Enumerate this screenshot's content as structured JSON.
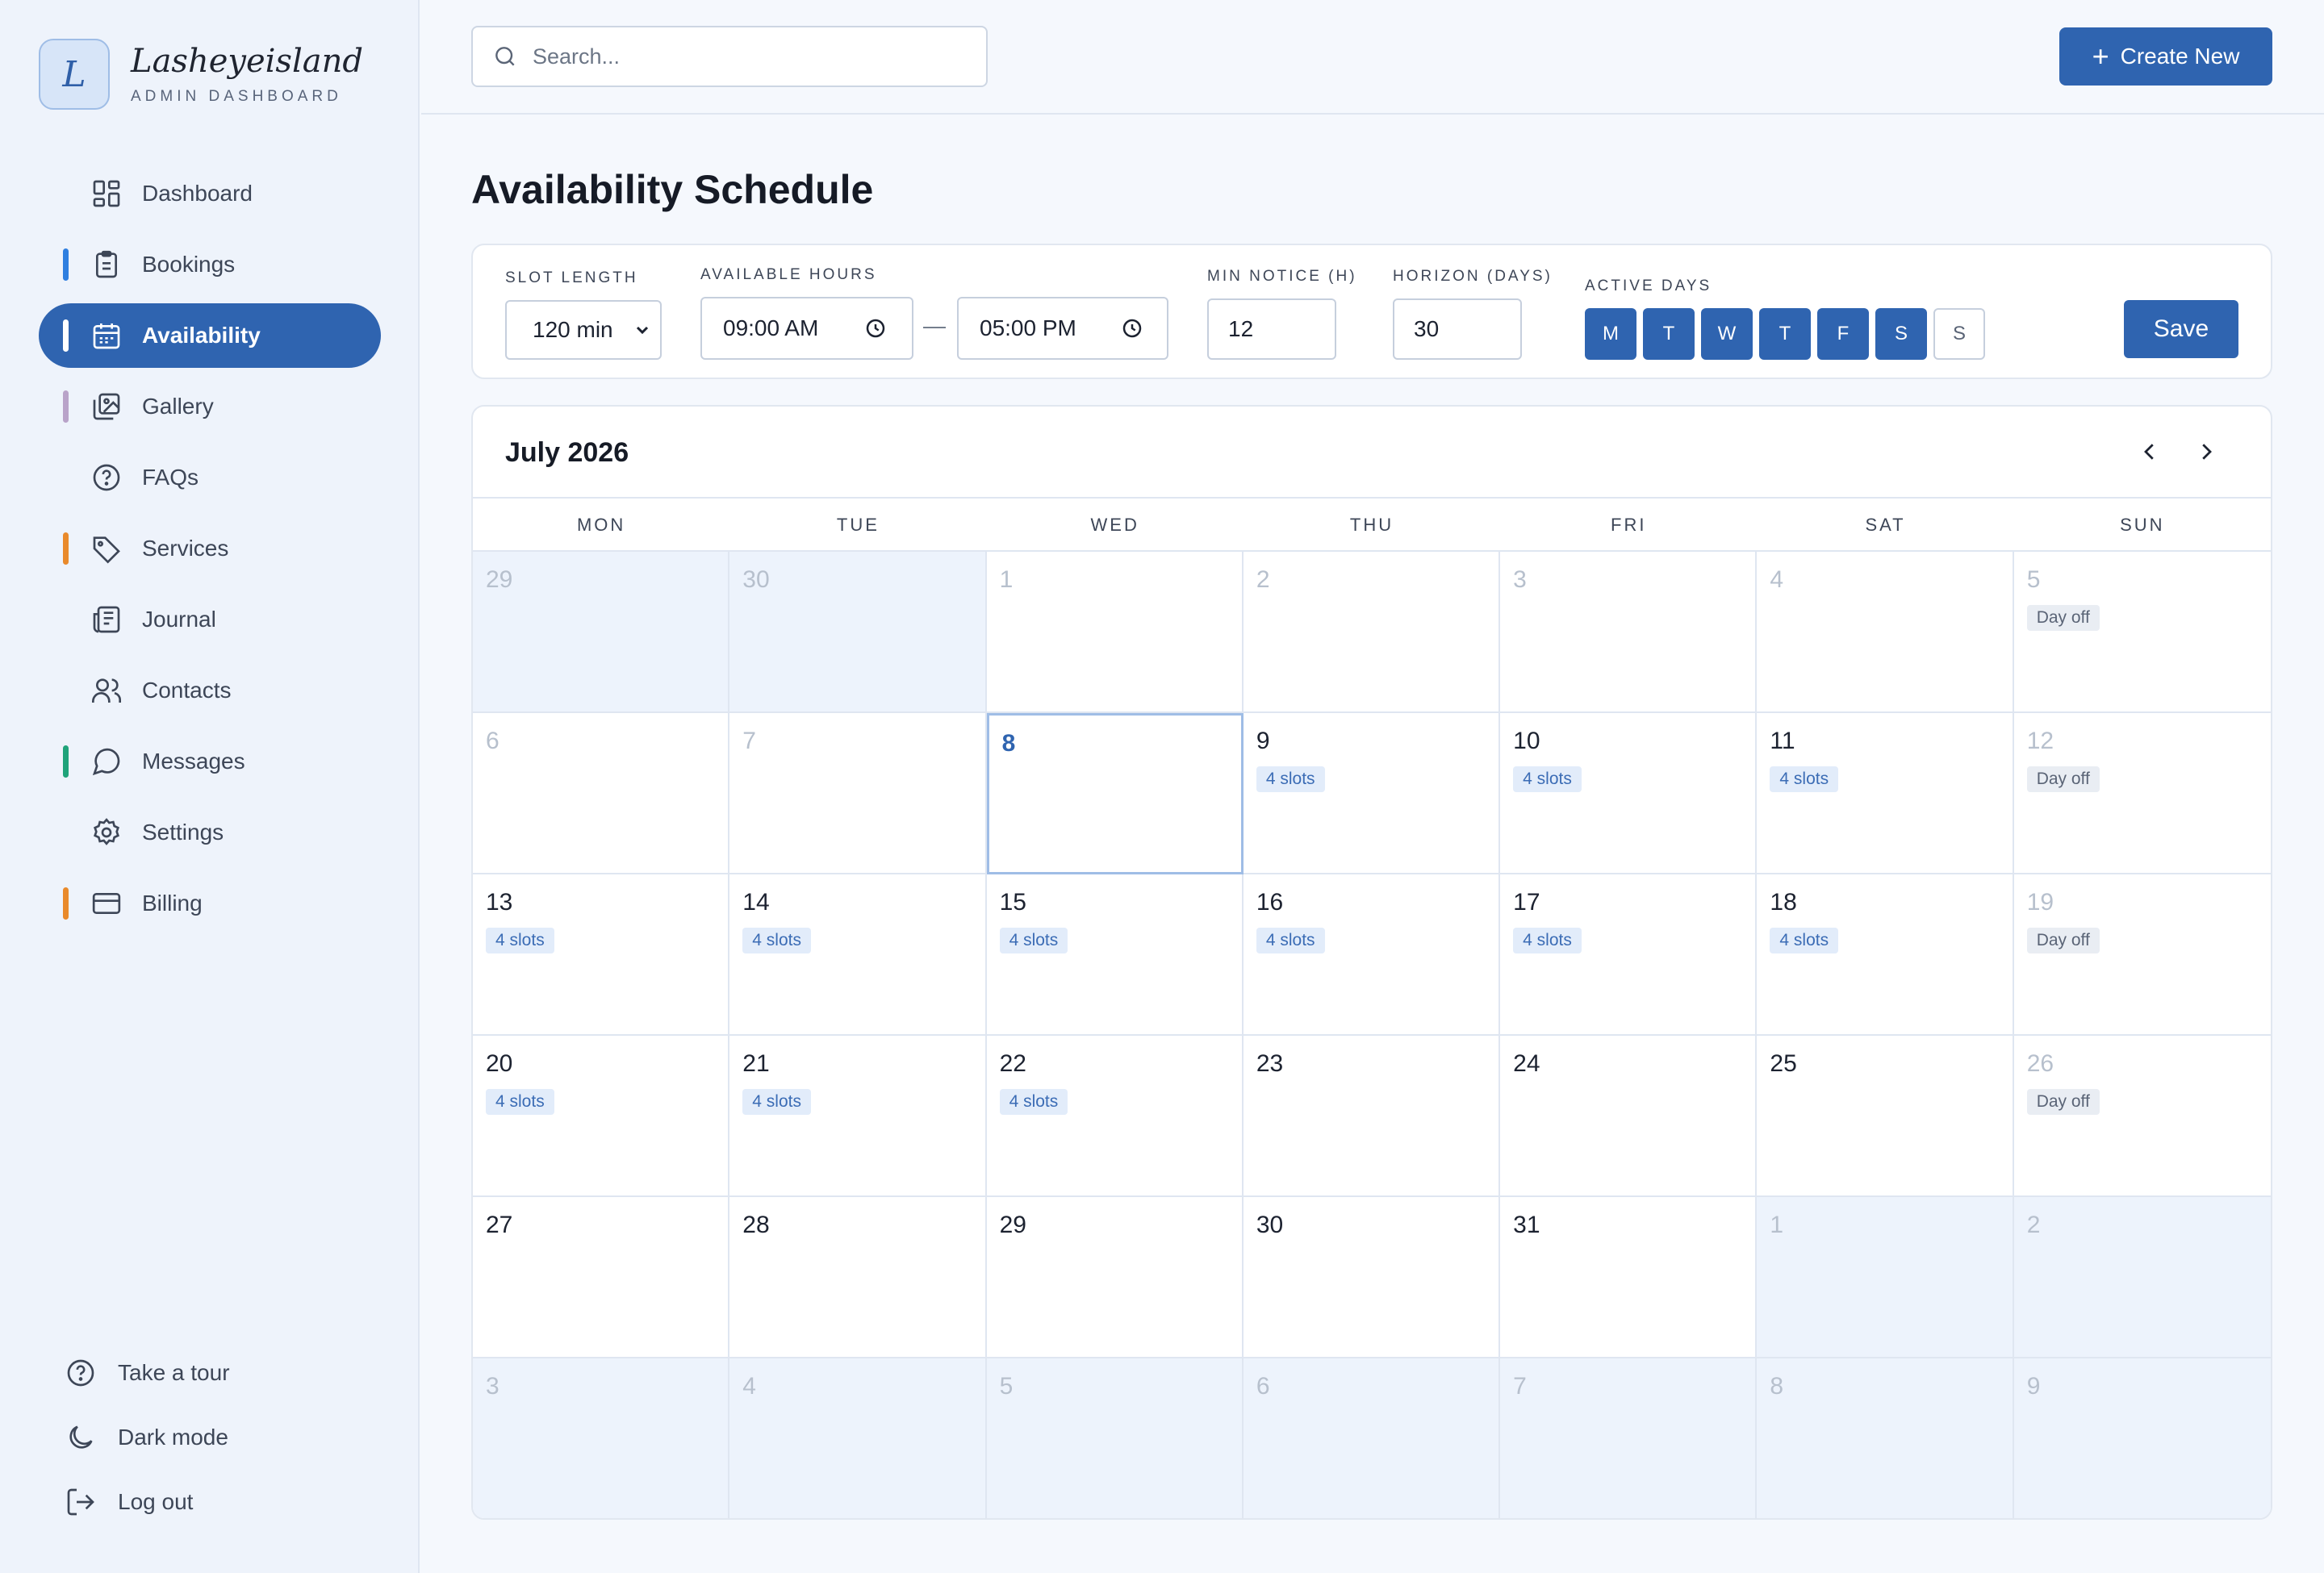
{
  "brand": {
    "initial": "L",
    "name": "Lasheyeisland",
    "subtitle": "ADMIN DASHBOARD"
  },
  "sidebar": {
    "items": [
      {
        "label": "Dashboard",
        "icon": "dashboard-icon",
        "accent": "",
        "active": false
      },
      {
        "label": "Bookings",
        "icon": "clipboard-icon",
        "accent": "#2f7fe0",
        "active": false
      },
      {
        "label": "Availability",
        "icon": "calendar-icon",
        "accent": "#ffffff",
        "active": true
      },
      {
        "label": "Gallery",
        "icon": "gallery-icon",
        "accent": "#b9a3c9",
        "active": false
      },
      {
        "label": "FAQs",
        "icon": "help-circle-icon",
        "accent": "",
        "active": false
      },
      {
        "label": "Services",
        "icon": "tag-icon",
        "accent": "#e98a2b",
        "active": false
      },
      {
        "label": "Journal",
        "icon": "newspaper-icon",
        "accent": "",
        "active": false
      },
      {
        "label": "Contacts",
        "icon": "users-icon",
        "accent": "",
        "active": false
      },
      {
        "label": "Messages",
        "icon": "message-icon",
        "accent": "#1fa37a",
        "active": false
      },
      {
        "label": "Settings",
        "icon": "gear-icon",
        "accent": "",
        "active": false
      },
      {
        "label": "Billing",
        "icon": "credit-card-icon",
        "accent": "#e98a2b",
        "active": false
      }
    ],
    "footer": [
      {
        "label": "Take a tour",
        "icon": "help-circle-icon"
      },
      {
        "label": "Dark mode",
        "icon": "moon-icon"
      },
      {
        "label": "Log out",
        "icon": "logout-icon"
      }
    ]
  },
  "topbar": {
    "search_placeholder": "Search...",
    "create_label": "Create New"
  },
  "page": {
    "title": "Availability Schedule"
  },
  "settings": {
    "slot_length_label": "SLOT LENGTH",
    "slot_length_value": "120 min",
    "available_hours_label": "AVAILABLE HOURS",
    "start_time": "09:00 AM",
    "end_time": "05:00 PM",
    "separator": "—",
    "min_notice_label": "MIN NOTICE (H)",
    "min_notice_value": "12",
    "horizon_label": "HORIZON (DAYS)",
    "horizon_value": "30",
    "active_days_label": "ACTIVE DAYS",
    "days": [
      {
        "label": "M",
        "active": true
      },
      {
        "label": "T",
        "active": true
      },
      {
        "label": "W",
        "active": true
      },
      {
        "label": "T",
        "active": true
      },
      {
        "label": "F",
        "active": true
      },
      {
        "label": "S",
        "active": true
      },
      {
        "label": "S",
        "active": false
      }
    ],
    "save_label": "Save"
  },
  "calendar": {
    "month_label": "July 2026",
    "weekdays": [
      "MON",
      "TUE",
      "WED",
      "THU",
      "FRI",
      "SAT",
      "SUN"
    ],
    "weeks": [
      [
        {
          "day": "29",
          "muted": true,
          "other": true,
          "badge": "",
          "badge_type": ""
        },
        {
          "day": "30",
          "muted": true,
          "other": true,
          "badge": "",
          "badge_type": ""
        },
        {
          "day": "1",
          "muted": true,
          "other": false,
          "badge": "",
          "badge_type": ""
        },
        {
          "day": "2",
          "muted": true,
          "other": false,
          "badge": "",
          "badge_type": ""
        },
        {
          "day": "3",
          "muted": true,
          "other": false,
          "badge": "",
          "badge_type": ""
        },
        {
          "day": "4",
          "muted": true,
          "other": false,
          "badge": "",
          "badge_type": ""
        },
        {
          "day": "5",
          "muted": true,
          "other": false,
          "badge": "Day off",
          "badge_type": "off"
        }
      ],
      [
        {
          "day": "6",
          "muted": true,
          "other": false,
          "badge": "",
          "badge_type": ""
        },
        {
          "day": "7",
          "muted": true,
          "other": false,
          "badge": "",
          "badge_type": ""
        },
        {
          "day": "8",
          "muted": false,
          "other": false,
          "today": true,
          "badge": "",
          "badge_type": ""
        },
        {
          "day": "9",
          "muted": false,
          "other": false,
          "badge": "4 slots",
          "badge_type": "slots"
        },
        {
          "day": "10",
          "muted": false,
          "other": false,
          "badge": "4 slots",
          "badge_type": "slots"
        },
        {
          "day": "11",
          "muted": false,
          "other": false,
          "badge": "4 slots",
          "badge_type": "slots"
        },
        {
          "day": "12",
          "muted": true,
          "other": false,
          "badge": "Day off",
          "badge_type": "off"
        }
      ],
      [
        {
          "day": "13",
          "muted": false,
          "other": false,
          "badge": "4 slots",
          "badge_type": "slots"
        },
        {
          "day": "14",
          "muted": false,
          "other": false,
          "badge": "4 slots",
          "badge_type": "slots"
        },
        {
          "day": "15",
          "muted": false,
          "other": false,
          "badge": "4 slots",
          "badge_type": "slots"
        },
        {
          "day": "16",
          "muted": false,
          "other": false,
          "badge": "4 slots",
          "badge_type": "slots"
        },
        {
          "day": "17",
          "muted": false,
          "other": false,
          "badge": "4 slots",
          "badge_type": "slots"
        },
        {
          "day": "18",
          "muted": false,
          "other": false,
          "badge": "4 slots",
          "badge_type": "slots"
        },
        {
          "day": "19",
          "muted": true,
          "other": false,
          "badge": "Day off",
          "badge_type": "off"
        }
      ],
      [
        {
          "day": "20",
          "muted": false,
          "other": false,
          "badge": "4 slots",
          "badge_type": "slots"
        },
        {
          "day": "21",
          "muted": false,
          "other": false,
          "badge": "4 slots",
          "badge_type": "slots"
        },
        {
          "day": "22",
          "muted": false,
          "other": false,
          "badge": "4 slots",
          "badge_type": "slots"
        },
        {
          "day": "23",
          "muted": false,
          "other": false,
          "badge": "",
          "badge_type": ""
        },
        {
          "day": "24",
          "muted": false,
          "other": false,
          "badge": "",
          "badge_type": ""
        },
        {
          "day": "25",
          "muted": false,
          "other": false,
          "badge": "",
          "badge_type": ""
        },
        {
          "day": "26",
          "muted": true,
          "other": false,
          "badge": "Day off",
          "badge_type": "off"
        }
      ],
      [
        {
          "day": "27",
          "muted": false,
          "other": false,
          "badge": "",
          "badge_type": ""
        },
        {
          "day": "28",
          "muted": false,
          "other": false,
          "badge": "",
          "badge_type": ""
        },
        {
          "day": "29",
          "muted": false,
          "other": false,
          "badge": "",
          "badge_type": ""
        },
        {
          "day": "30",
          "muted": false,
          "other": false,
          "badge": "",
          "badge_type": ""
        },
        {
          "day": "31",
          "muted": false,
          "other": false,
          "badge": "",
          "badge_type": ""
        },
        {
          "day": "1",
          "muted": true,
          "other": true,
          "badge": "",
          "badge_type": ""
        },
        {
          "day": "2",
          "muted": true,
          "other": true,
          "badge": "",
          "badge_type": ""
        }
      ],
      [
        {
          "day": "3",
          "muted": true,
          "other": true,
          "badge": "",
          "badge_type": ""
        },
        {
          "day": "4",
          "muted": true,
          "other": true,
          "badge": "",
          "badge_type": ""
        },
        {
          "day": "5",
          "muted": true,
          "other": true,
          "badge": "",
          "badge_type": ""
        },
        {
          "day": "6",
          "muted": true,
          "other": true,
          "badge": "",
          "badge_type": ""
        },
        {
          "day": "7",
          "muted": true,
          "other": true,
          "badge": "",
          "badge_type": ""
        },
        {
          "day": "8",
          "muted": true,
          "other": true,
          "badge": "",
          "badge_type": ""
        },
        {
          "day": "9",
          "muted": true,
          "other": true,
          "badge": "",
          "badge_type": ""
        }
      ]
    ]
  },
  "colors": {
    "primary": "#2f64b0",
    "today_border": "#9fbde6",
    "slot_badge_bg": "#e2ecfa",
    "other_month_bg": "#edf3fc"
  }
}
